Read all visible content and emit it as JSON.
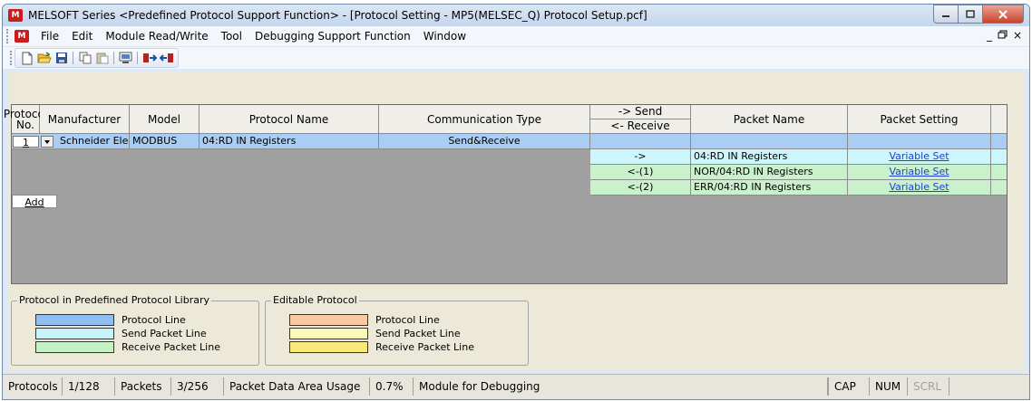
{
  "window": {
    "title": "MELSOFT Series <Predefined Protocol Support Function> - [Protocol Setting - MP5(MELSEC_Q) Protocol Setup.pcf]",
    "app_icon_glyph": "M"
  },
  "menu": {
    "items": [
      "File",
      "Edit",
      "Module Read/Write",
      "Tool",
      "Debugging Support Function",
      "Window"
    ],
    "mdi_min": "_",
    "mdi_restore": "Š",
    "mdi_close": "×"
  },
  "toolbar": {
    "icons": [
      "new-file-icon",
      "open-folder-icon",
      "save-icon",
      "copy-icon",
      "paste-icon",
      "print-preview-icon",
      "write-module-icon",
      "read-module-icon"
    ]
  },
  "grid": {
    "headers": {
      "protocol_no": "Protocol No.",
      "manufacturer": "Manufacturer",
      "model": "Model",
      "protocol_name": "Protocol Name",
      "communication_type": "Communication Type",
      "send": "-> Send",
      "receive": "<- Receive",
      "packet_name": "Packet Name",
      "packet_setting": "Packet Setting"
    },
    "protocol_row": {
      "number": "1",
      "manufacturer": "Schneider Electri",
      "model": "MODBUS",
      "protocol_name": "04:RD IN Registers",
      "communication_type": "Send&Receive"
    },
    "packets": [
      {
        "direction": "->",
        "name": "04:RD IN Registers",
        "setting": "Variable Set",
        "kind": "send"
      },
      {
        "direction": "<-(1)",
        "name": "NOR/04:RD IN Registers",
        "setting": "Variable Set",
        "kind": "receive"
      },
      {
        "direction": "<-(2)",
        "name": "ERR/04:RD IN Registers",
        "setting": "Variable Set",
        "kind": "receive"
      }
    ],
    "add_label": "Add"
  },
  "legend": {
    "library": {
      "title": "Protocol in Predefined Protocol Library",
      "items": [
        {
          "label": "Protocol Line",
          "color": "#8fbef0"
        },
        {
          "label": "Send Packet Line",
          "color": "#c6f4fb"
        },
        {
          "label": "Receive Packet Line",
          "color": "#c4f2c6"
        }
      ]
    },
    "editable": {
      "title": "Editable Protocol",
      "items": [
        {
          "label": "Protocol Line",
          "color": "#f9c9a3"
        },
        {
          "label": "Send Packet Line",
          "color": "#fcf8b6"
        },
        {
          "label": "Receive Packet Line",
          "color": "#f8e97a"
        }
      ]
    }
  },
  "status": {
    "protocols_label": "Protocols",
    "protocols_value": "1/128",
    "packets_label": "Packets",
    "packets_value": "3/256",
    "usage_label": "Packet Data Area Usage",
    "usage_value": "0.7%",
    "mode": "Module for Debugging",
    "cap": "CAP",
    "num": "NUM",
    "scrl": "SCRL"
  }
}
